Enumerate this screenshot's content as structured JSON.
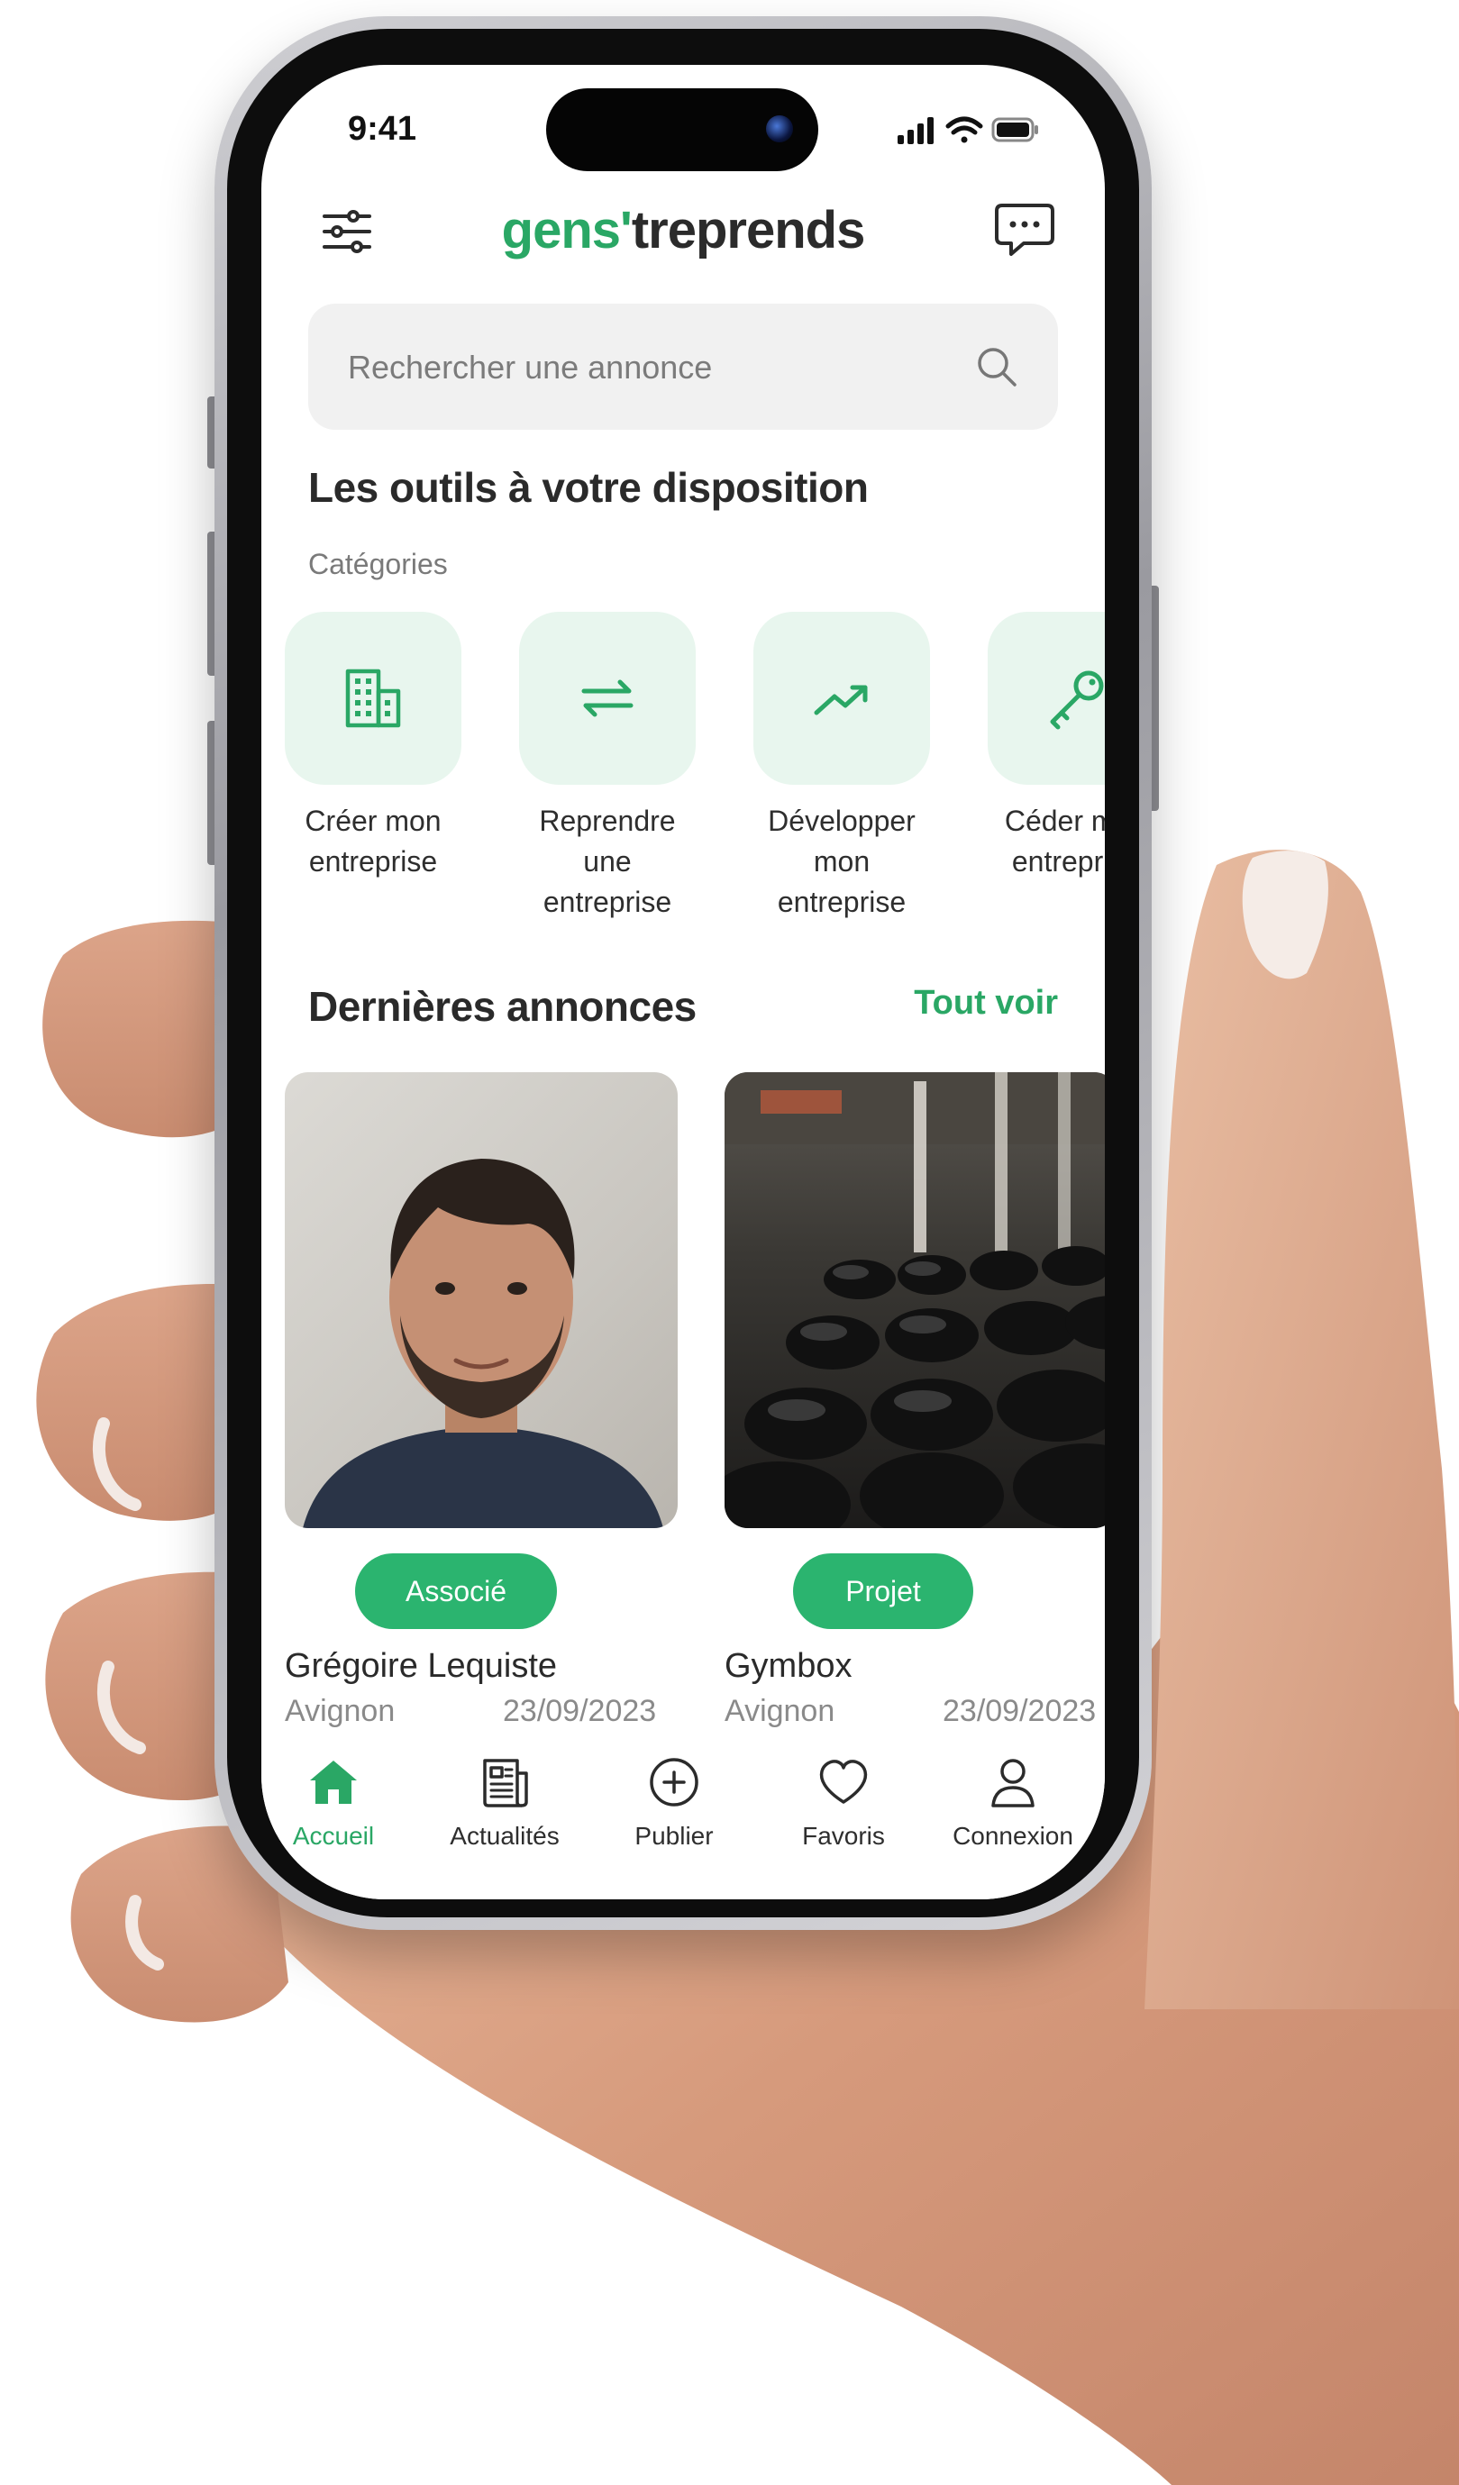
{
  "status_bar": {
    "time": "9:41"
  },
  "header": {
    "logo_green": "gens'",
    "logo_dark": "treprends"
  },
  "search": {
    "placeholder": "Rechercher une annonce"
  },
  "tools": {
    "title": "Les outils à votre disposition",
    "subtitle": "Catégories",
    "categories": [
      {
        "label": "Créer mon entreprise",
        "icon": "building-icon"
      },
      {
        "label": "Reprendre une entreprise",
        "icon": "swap-arrows-icon"
      },
      {
        "label": "Développer mon entreprise",
        "icon": "trend-up-icon"
      },
      {
        "label": "Céder mon entreprise",
        "icon": "key-icon"
      }
    ]
  },
  "listings": {
    "title": "Dernières annonces",
    "see_all": "Tout voir",
    "items": [
      {
        "tag": "Associé",
        "name": "Grégoire Lequiste",
        "city": "Avignon",
        "date": "23/09/2023"
      },
      {
        "tag": "Projet",
        "name": "Gymbox",
        "city": "Avignon",
        "date": "23/09/2023"
      }
    ]
  },
  "bottom_nav": {
    "items": [
      {
        "label": "Accueil",
        "icon": "home-icon",
        "active": true
      },
      {
        "label": "Actualités",
        "icon": "newspaper-icon",
        "active": false
      },
      {
        "label": "Publier",
        "icon": "plus-circle-icon",
        "active": false
      },
      {
        "label": "Favoris",
        "icon": "heart-icon",
        "active": false
      },
      {
        "label": "Connexion",
        "icon": "user-icon",
        "active": false
      }
    ]
  },
  "colors": {
    "accent": "#2aa765",
    "tag": "#2bb46f",
    "tile": "#e8f6ee",
    "search_bg": "#f1f1f1"
  }
}
